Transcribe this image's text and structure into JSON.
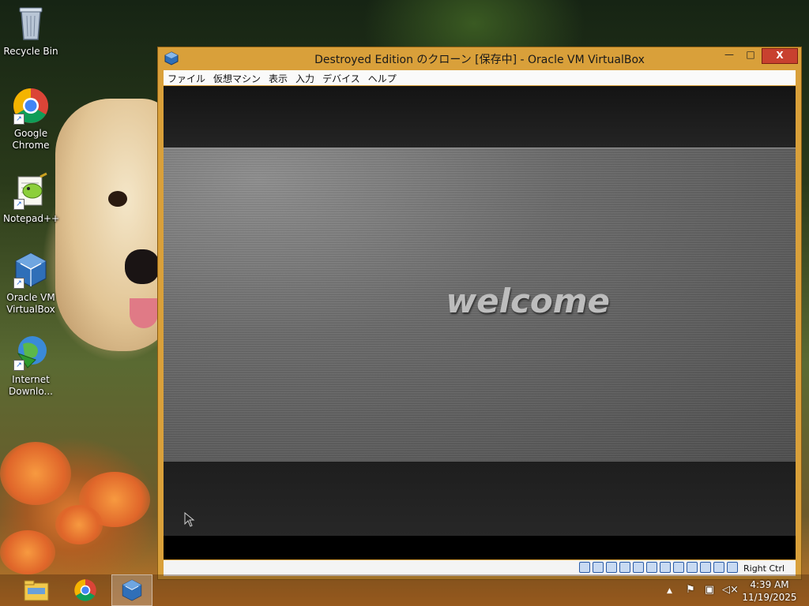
{
  "desktop": {
    "icons": [
      {
        "label": "Recycle Bin"
      },
      {
        "label": "Google Chrome"
      },
      {
        "label": "Notepad++"
      },
      {
        "label": "Oracle VM VirtualBox"
      },
      {
        "label": "Internet Downlo..."
      }
    ]
  },
  "window": {
    "title": "Destroyed Edition のクローン [保存中] - Oracle VM VirtualBox",
    "controls": {
      "minimize": "—",
      "maximize": "□",
      "close": "X"
    },
    "menu": [
      "ファイル",
      "仮想マシン",
      "表示",
      "入力",
      "デバイス",
      "ヘルプ"
    ],
    "guest_screen_text": "welcome",
    "status_host_key": "Right Ctrl"
  },
  "taskbar": {
    "clock_time": "4:39 AM",
    "clock_date": "11/19/2025",
    "tray_arrow": "▲"
  },
  "colors": {
    "window_frame": "#d9a03a",
    "close_button": "#c8412f",
    "welcome_text": "#bdbdbd"
  }
}
